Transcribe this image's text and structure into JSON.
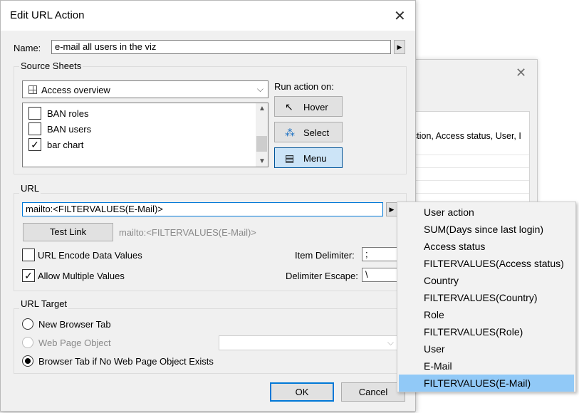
{
  "dialog": {
    "title": "Edit URL Action",
    "name_label": "Name:",
    "name_value": "e-mail all users in the viz"
  },
  "source_sheets": {
    "title": "Source Sheets",
    "combo_value": "Access overview",
    "items": [
      {
        "label": "BAN roles",
        "checked": false
      },
      {
        "label": "BAN users",
        "checked": false
      },
      {
        "label": "bar chart",
        "checked": true
      }
    ],
    "run_label": "Run action on:",
    "run_buttons": [
      {
        "label": "Hover",
        "icon": "cursor-icon"
      },
      {
        "label": "Select",
        "icon": "select-icon"
      },
      {
        "label": "Menu",
        "icon": "menu-icon",
        "selected": true
      }
    ]
  },
  "url": {
    "title": "URL",
    "value": "mailto:<FILTERVALUES(E-Mail)>",
    "test_link_label": "Test Link",
    "preview": "mailto:<FILTERVALUES(E-Mail)>",
    "encode_label": "URL Encode Data Values",
    "encode_checked": false,
    "multiple_label": "Allow Multiple Values",
    "multiple_checked": true,
    "item_delimiter_label": "Item Delimiter:",
    "item_delimiter_value": ";",
    "delimiter_escape_label": "Delimiter Escape:",
    "delimiter_escape_value": "\\"
  },
  "url_target": {
    "title": "URL Target",
    "options": [
      {
        "label": "New Browser Tab",
        "selected": false,
        "disabled": false
      },
      {
        "label": "Web Page Object",
        "selected": false,
        "disabled": true
      },
      {
        "label": "Browser Tab if No Web Page Object Exists",
        "selected": true,
        "disabled": false
      }
    ]
  },
  "footer": {
    "ok_label": "OK",
    "cancel_label": "Cancel"
  },
  "background": {
    "partial_text": "ction, Access status, User, I"
  },
  "insert_menu": {
    "items": [
      "User action",
      "SUM(Days since last login)",
      "Access status",
      "FILTERVALUES(Access status)",
      "Country",
      "FILTERVALUES(Country)",
      "Role",
      "FILTERVALUES(Role)",
      "User",
      "E-Mail",
      "FILTERVALUES(E-Mail)"
    ],
    "highlighted_index": 10
  }
}
